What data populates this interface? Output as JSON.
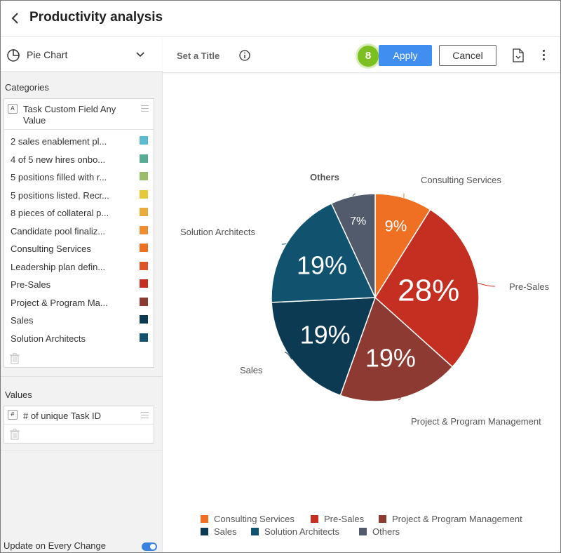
{
  "header": {
    "title": "Productivity analysis"
  },
  "left_panel": {
    "chart_type": "Pie Chart",
    "categories_label": "Categories",
    "category_field": "Task Custom Field Any Value",
    "category_field_icon": "text-field-icon",
    "items": [
      {
        "label": "2 sales enablement pl...",
        "color": "#5bbcd0"
      },
      {
        "label": "4 of 5 new hires onbo...",
        "color": "#5aab94"
      },
      {
        "label": "5 positions filled with r...",
        "color": "#9bbc6a"
      },
      {
        "label": "5 positions listed. Recr...",
        "color": "#e6c83a"
      },
      {
        "label": "8 pieces of collateral p...",
        "color": "#eaaa3c"
      },
      {
        "label": "Candidate pool finaliz...",
        "color": "#ef8d35"
      },
      {
        "label": "Consulting Services",
        "color": "#ef7023"
      },
      {
        "label": "Leadership plan defin...",
        "color": "#dc5427"
      },
      {
        "label": "Pre-Sales",
        "color": "#c42f21"
      },
      {
        "label": "Project & Program Ma...",
        "color": "#8d3b32"
      },
      {
        "label": "Sales",
        "color": "#0d3a53"
      },
      {
        "label": "Solution Architects",
        "color": "#11536f"
      }
    ],
    "values_label": "Values",
    "value_field": "# of unique Task ID",
    "value_field_icon": "number-field-icon",
    "update_label": "Update on Every Change",
    "update_on": true
  },
  "toolbar": {
    "set_title": "Set a Title",
    "step": "8",
    "apply": "Apply",
    "cancel": "Cancel"
  },
  "chart_data": {
    "type": "pie",
    "title": "",
    "slices": [
      {
        "name": "Consulting Services",
        "value": 9,
        "label": "9%",
        "color": "#ef7023"
      },
      {
        "name": "Pre-Sales",
        "value": 28,
        "label": "28%",
        "color": "#c42f21"
      },
      {
        "name": "Project & Program Management",
        "value": 19,
        "label": "19%",
        "color": "#8d3b32"
      },
      {
        "name": "Sales",
        "value": 19,
        "label": "19%",
        "color": "#0d3a53"
      },
      {
        "name": "Solution Architects",
        "value": 19,
        "label": "19%",
        "color": "#11536f"
      },
      {
        "name": "Others",
        "value": 7,
        "label": "7%",
        "color": "#525b6b"
      }
    ],
    "legend_position": "bottom"
  }
}
